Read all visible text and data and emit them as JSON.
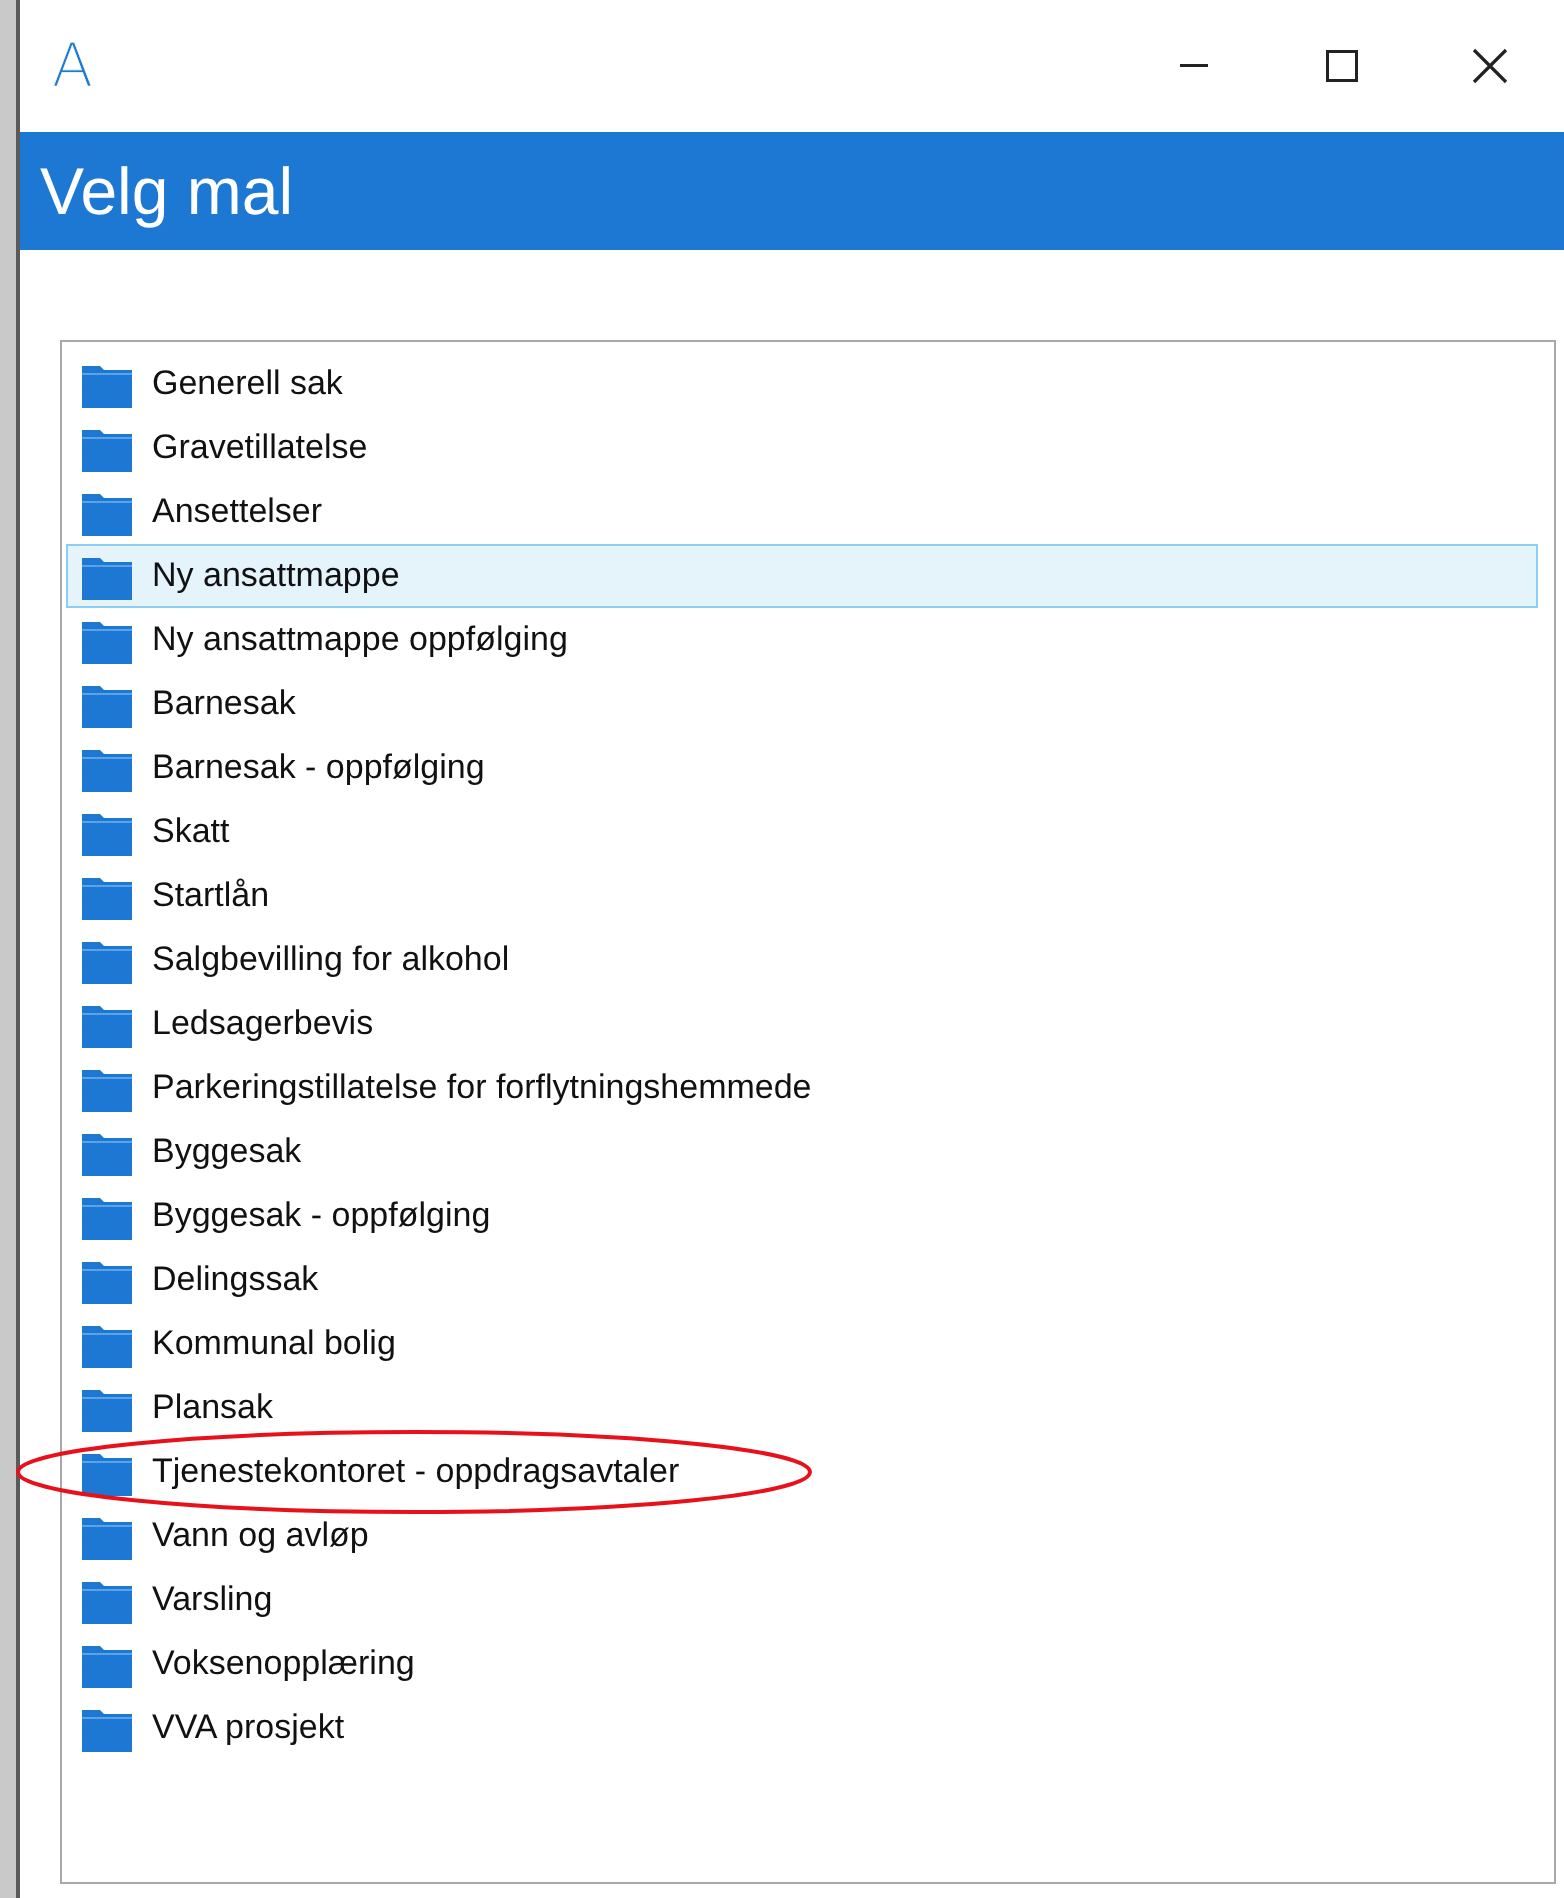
{
  "window": {
    "logo": "A",
    "title": "Velg mal"
  },
  "templates": [
    {
      "label": "Generell sak",
      "selected": false,
      "circled": false
    },
    {
      "label": "Gravetillatelse",
      "selected": false,
      "circled": false
    },
    {
      "label": "Ansettelser",
      "selected": false,
      "circled": false
    },
    {
      "label": "Ny ansattmappe",
      "selected": true,
      "circled": false
    },
    {
      "label": "Ny ansattmappe oppfølging",
      "selected": false,
      "circled": false
    },
    {
      "label": "Barnesak",
      "selected": false,
      "circled": false
    },
    {
      "label": "Barnesak - oppfølging",
      "selected": false,
      "circled": false
    },
    {
      "label": "Skatt",
      "selected": false,
      "circled": false
    },
    {
      "label": "Startlån",
      "selected": false,
      "circled": false
    },
    {
      "label": "Salgbevilling for alkohol",
      "selected": false,
      "circled": false
    },
    {
      "label": "Ledsagerbevis",
      "selected": false,
      "circled": false
    },
    {
      "label": "Parkeringstillatelse for forflytningshemmede",
      "selected": false,
      "circled": false
    },
    {
      "label": "Byggesak",
      "selected": false,
      "circled": false
    },
    {
      "label": "Byggesak - oppfølging",
      "selected": false,
      "circled": false
    },
    {
      "label": "Delingssak",
      "selected": false,
      "circled": false
    },
    {
      "label": "Kommunal bolig",
      "selected": false,
      "circled": false
    },
    {
      "label": "Plansak",
      "selected": false,
      "circled": false
    },
    {
      "label": "Tjenestekontoret - oppdragsavtaler",
      "selected": false,
      "circled": true
    },
    {
      "label": "Vann og avløp",
      "selected": false,
      "circled": false
    },
    {
      "label": "Varsling",
      "selected": false,
      "circled": false
    },
    {
      "label": "Voksenopplæring",
      "selected": false,
      "circled": false
    },
    {
      "label": "VVA prosjekt",
      "selected": false,
      "circled": false
    }
  ]
}
